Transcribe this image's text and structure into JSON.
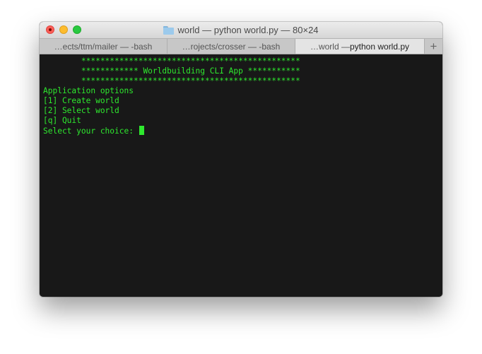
{
  "window": {
    "title": "world — python world.py — 80×24",
    "folder_icon": "folder-icon"
  },
  "tabs": [
    {
      "label": "…ects/ttm/mailer — -bash"
    },
    {
      "label_prefix": "…rojects/crosser — -bash"
    },
    {
      "label_prefix": "…world — ",
      "label_main": "python world.py"
    }
  ],
  "add_tab_label": "+",
  "terminal": {
    "lines": [
      "        **********************************************",
      "        ************ Worldbuilding CLI App ***********",
      "        **********************************************",
      "Application options",
      "[1] Create world",
      "[2] Select world",
      "[q] Quit",
      "Select your choice: "
    ]
  },
  "colors": {
    "terminal_bg": "#181818",
    "terminal_text": "#2ee82e",
    "close": "#fc5f57",
    "minimize": "#fdbc2e",
    "maximize": "#28c840"
  }
}
